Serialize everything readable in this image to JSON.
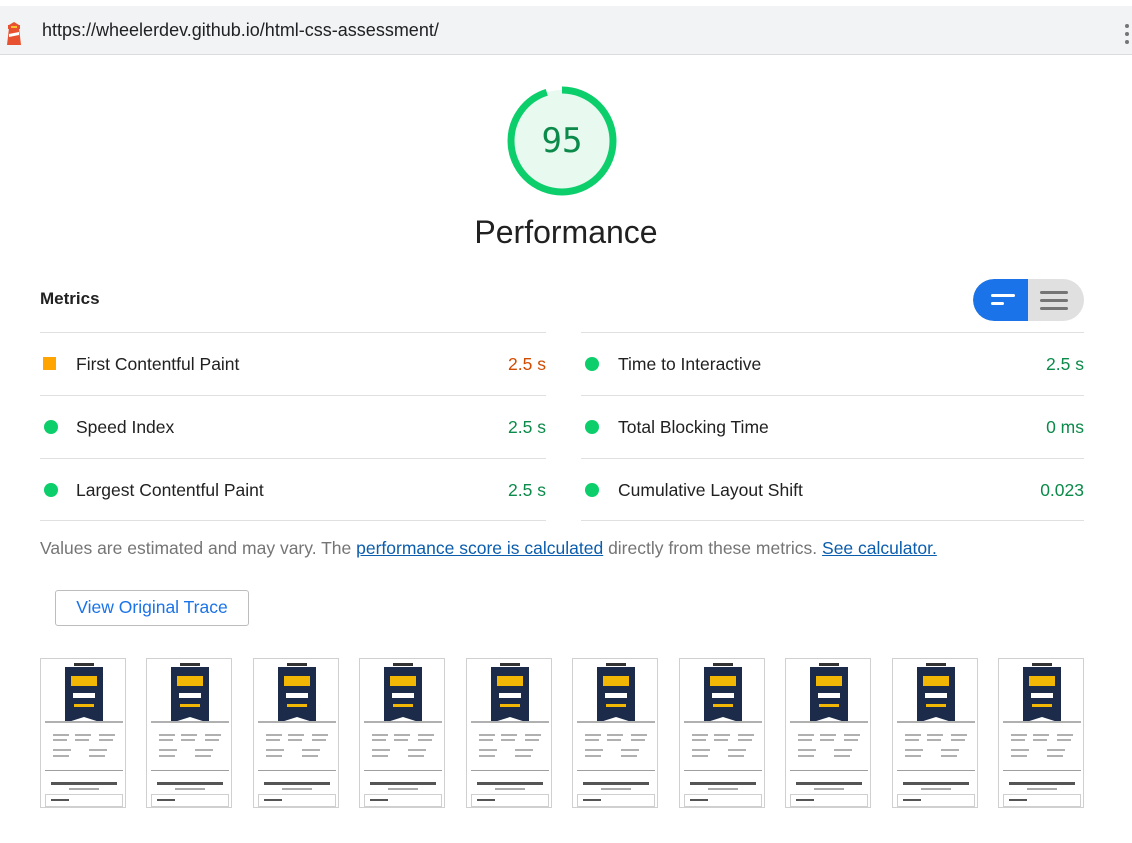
{
  "url_bar": {
    "url": "https://wheelerdev.github.io/html-css-assessment/",
    "icon": "lighthouse-icon",
    "menu_icon": "vertical-dots-icon"
  },
  "gauge": {
    "score": "95",
    "title": "Performance",
    "fraction": 0.95,
    "color": "#0cce6b"
  },
  "metrics": {
    "title": "Metrics",
    "toggle": {
      "active": "compact-view",
      "icons": [
        "compact-view-icon",
        "expanded-view-icon"
      ]
    },
    "left": [
      {
        "label": "First Contentful Paint",
        "value": "2.5 s",
        "rating": "average",
        "icon": "orange-square-icon"
      },
      {
        "label": "Speed Index",
        "value": "2.5 s",
        "rating": "pass",
        "icon": "green-circle-icon"
      },
      {
        "label": "Largest Contentful Paint",
        "value": "2.5 s",
        "rating": "pass",
        "icon": "green-circle-icon"
      }
    ],
    "right": [
      {
        "label": "Time to Interactive",
        "value": "2.5 s",
        "rating": "pass",
        "icon": "green-circle-icon"
      },
      {
        "label": "Total Blocking Time",
        "value": "0 ms",
        "rating": "pass",
        "icon": "green-circle-icon"
      },
      {
        "label": "Cumulative Layout Shift",
        "value": "0.023",
        "rating": "pass",
        "icon": "green-circle-icon"
      }
    ]
  },
  "note": {
    "prefix": "Values are estimated and may vary. The ",
    "link1": "performance score is calculated",
    "middle": " directly from these metrics.",
    "link2": "See calculator."
  },
  "trace_button": "View Original Trace",
  "filmstrip": {
    "frame_count": 10
  },
  "colors": {
    "pass": "#0cce6b",
    "pass_text": "#0b8a4a",
    "average": "#ffa400",
    "average_text": "#d14b00",
    "accent": "#1a73e8"
  }
}
